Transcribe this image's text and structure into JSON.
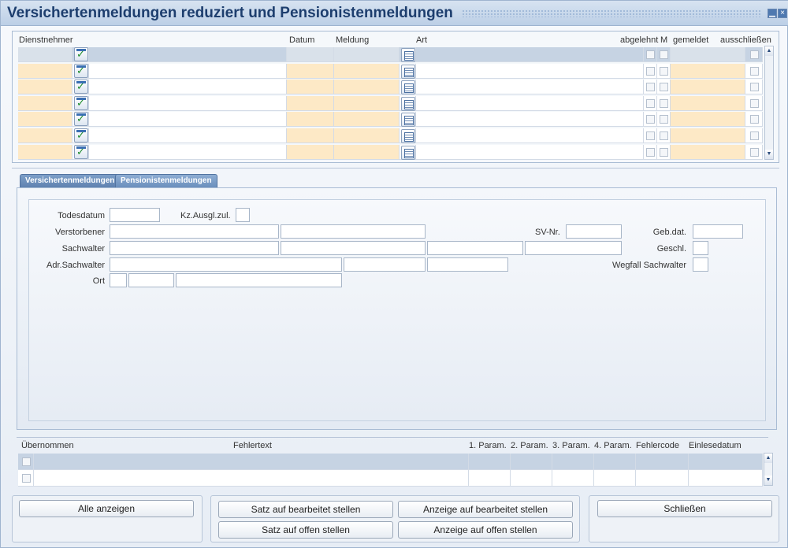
{
  "window": {
    "title": "Versichertenmeldungen reduziert und Pensionistenmeldungen",
    "minimize_icon": "minimize-icon",
    "close_icon": "close-icon"
  },
  "top_grid": {
    "headers": {
      "dienstnehmer": "Dienstnehmer",
      "datum": "Datum",
      "meldung": "Meldung",
      "art": "Art",
      "abgelehnt": "abgelehnt",
      "m": "M",
      "gemeldet": "gemeldet",
      "ausschliessen": "ausschließen"
    },
    "row_count": 7,
    "row_icon": "check-document-icon",
    "art_icon": "document-list-icon"
  },
  "tabs": [
    {
      "label": "Versichertenmeldungen",
      "active": false
    },
    {
      "label": "Pensionistenmeldungen",
      "active": true
    }
  ],
  "form": {
    "todesdatum": "Todesdatum",
    "kz_ausgl": "Kz.Ausgl.zul.",
    "verstorbener": "Verstorbener",
    "sv_nr": "SV-Nr.",
    "geb_dat": "Geb.dat.",
    "sachwalter": "Sachwalter",
    "geschl": "Geschl.",
    "adr_sachwalter": "Adr.Sachwalter",
    "wegfall_sachwalter": "Wegfall Sachwalter",
    "ort": "Ort"
  },
  "error_grid": {
    "headers": {
      "uebernommen": "Übernommen",
      "fehlertext": "Fehlertext",
      "param1": "1. Param.",
      "param2": "2. Param.",
      "param3": "3. Param.",
      "param4": "4. Param.",
      "fehlercode": "Fehlercode",
      "einlesedatum": "Einlesedatum"
    },
    "row_count": 2
  },
  "buttons": {
    "alle_anzeigen": "Alle anzeigen",
    "satz_bearbeitet": "Satz auf bearbeitet stellen",
    "anzeige_bearbeitet": "Anzeige auf bearbeitet stellen",
    "satz_offen": "Satz auf offen stellen",
    "anzeige_offen": "Anzeige auf offen stellen",
    "schliessen": "Schließen"
  },
  "colors": {
    "title_text": "#1d3e6e",
    "row_highlight": "#fde9c6",
    "tab_bg": "#6b8fbd"
  }
}
